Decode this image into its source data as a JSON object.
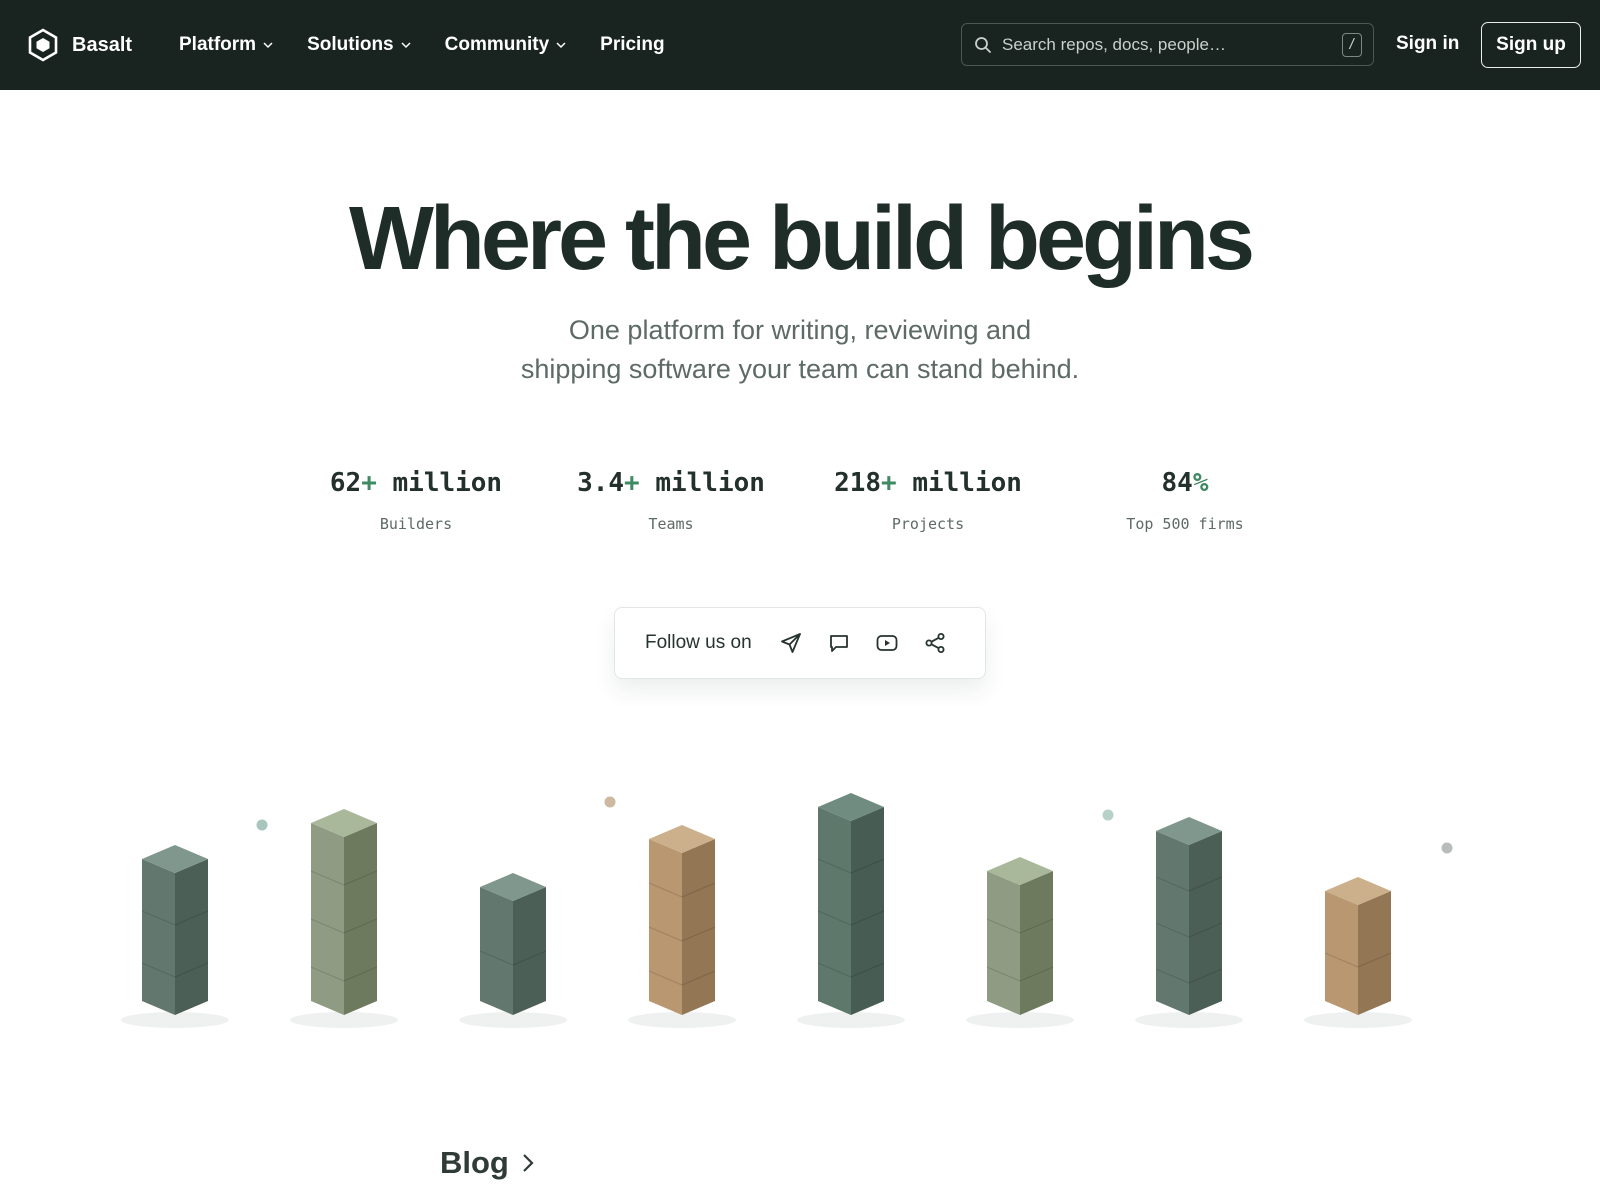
{
  "brand": {
    "name": "Basalt"
  },
  "nav": {
    "items": [
      {
        "label": "Platform",
        "has_menu": true
      },
      {
        "label": "Solutions",
        "has_menu": true
      },
      {
        "label": "Community",
        "has_menu": true
      },
      {
        "label": "Pricing",
        "has_menu": false
      }
    ]
  },
  "search": {
    "placeholder": "Search repos, docs, people…",
    "shortcut": "/"
  },
  "auth": {
    "signin_label": "Sign in",
    "signup_label": "Sign up"
  },
  "hero": {
    "title": "Where the build begins",
    "subtitle_line1": "One platform for writing, reviewing and",
    "subtitle_line2": "shipping software your team can stand behind."
  },
  "stats": [
    {
      "number": "62",
      "plus": "+",
      "unit": " million",
      "label": "Builders"
    },
    {
      "number": "3.4",
      "plus": "+",
      "unit": " million",
      "label": "Teams"
    },
    {
      "number": "218",
      "plus": "+",
      "unit": " million",
      "label": "Projects"
    },
    {
      "number": "84",
      "plus": "%",
      "unit": "",
      "label": "Top 500 firms"
    }
  ],
  "follow": {
    "label": "Follow us on",
    "icons": [
      "paper-plane-icon",
      "chat-bubble-icon",
      "video-play-icon",
      "share-icon"
    ]
  },
  "illustration": {
    "towers": [
      {
        "blocks": 3,
        "tone": "slate-green"
      },
      {
        "blocks": 4,
        "tone": "sage"
      },
      {
        "blocks": 2,
        "tone": "slate-green"
      },
      {
        "blocks": 4,
        "tone": "sand"
      },
      {
        "blocks": 4,
        "tone": "deep-green"
      },
      {
        "blocks": 3,
        "tone": "sage"
      },
      {
        "blocks": 4,
        "tone": "slate-green"
      },
      {
        "blocks": 2,
        "tone": "sand"
      }
    ],
    "palette": {
      "slate-green": {
        "top": "#7f978c",
        "left": "#62786e",
        "right": "#4b5f56"
      },
      "sage": {
        "top": "#a9b89a",
        "left": "#8f9c83",
        "right": "#6d7a5e"
      },
      "sand": {
        "top": "#cbb08b",
        "left": "#b99770",
        "right": "#937653"
      },
      "deep-green": {
        "top": "#708b7f",
        "left": "#5f786c",
        "right": "#475c52"
      }
    }
  },
  "colors": {
    "nav_bg": "#19231f",
    "accent": "#3f8a63",
    "text_dark": "#1f2d28",
    "text_muted": "#5d6a65"
  },
  "blog": {
    "label": "Blog"
  }
}
